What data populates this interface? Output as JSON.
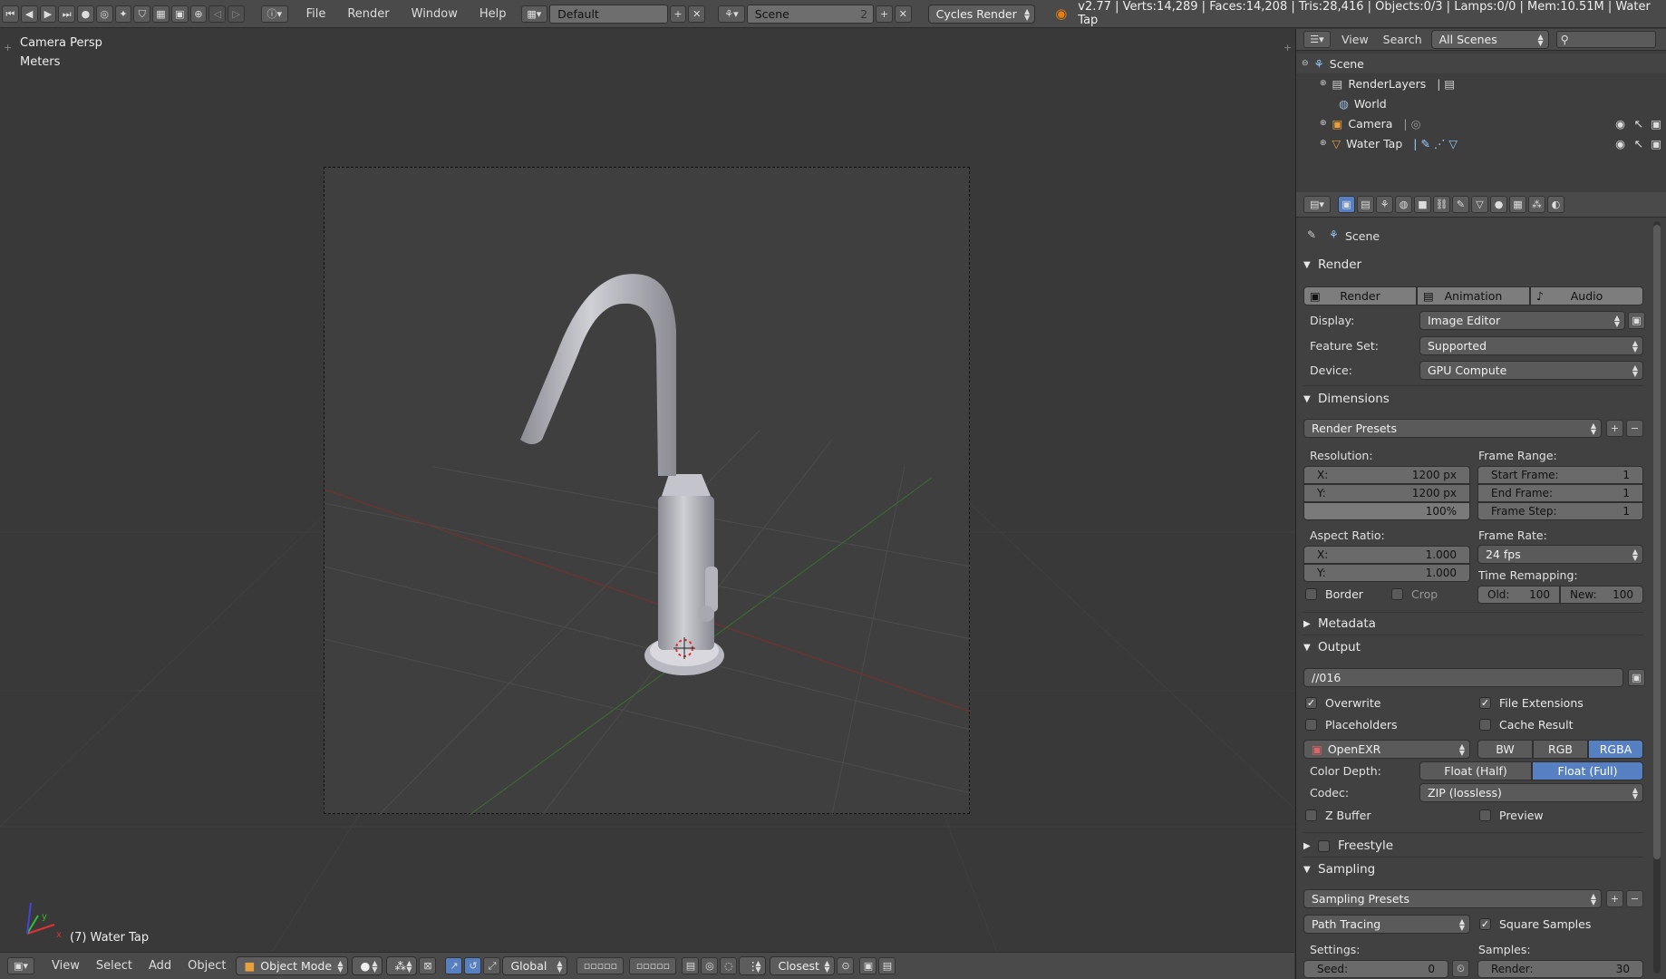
{
  "topbar": {
    "menus": [
      "File",
      "Render",
      "Window",
      "Help"
    ],
    "layout_name": "Default",
    "scene_name": "Scene",
    "scene_users": "2",
    "engine": "Cycles Render",
    "stats": "v2.77 | Verts:14,289 | Faces:14,208 | Tris:28,416 | Objects:0/3 | Lamps:0/0 | Mem:10.51M | Water Tap"
  },
  "viewport": {
    "view_name": "Camera Persp",
    "units": "Meters",
    "object_label": "(7) Water Tap"
  },
  "bottombar": {
    "menus": [
      "View",
      "Select",
      "Add",
      "Object"
    ],
    "mode": "Object Mode",
    "orientation": "Global",
    "snap": "Closest"
  },
  "outliner": {
    "view_label": "View",
    "search_label": "Search",
    "display_mode": "All Scenes",
    "items": [
      {
        "label": "Scene"
      },
      {
        "label": "RenderLayers"
      },
      {
        "label": "World"
      },
      {
        "label": "Camera"
      },
      {
        "label": "Water Tap"
      }
    ]
  },
  "properties": {
    "context": "Scene",
    "render": {
      "title": "Render",
      "buttons": [
        "Render",
        "Animation",
        "Audio"
      ],
      "display_label": "Display:",
      "display_value": "Image Editor",
      "feature_label": "Feature Set:",
      "feature_value": "Supported",
      "device_label": "Device:",
      "device_value": "GPU Compute"
    },
    "dimensions": {
      "title": "Dimensions",
      "presets": "Render Presets",
      "resolution_label": "Resolution:",
      "res_x_label": "X:",
      "res_x": "1200 px",
      "res_y_label": "Y:",
      "res_y": "1200 px",
      "res_pct": "100%",
      "frame_range_label": "Frame Range:",
      "start_label": "Start Frame:",
      "start": "1",
      "end_label": "End Frame:",
      "end": "1",
      "step_label": "Frame Step:",
      "step": "1",
      "aspect_label": "Aspect Ratio:",
      "aspect_x_label": "X:",
      "aspect_x": "1.000",
      "aspect_y_label": "Y:",
      "aspect_y": "1.000",
      "frame_rate_label": "Frame Rate:",
      "frame_rate": "24 fps",
      "border_label": "Border",
      "crop_label": "Crop",
      "remap_label": "Time Remapping:",
      "old_label": "Old:",
      "old": "100",
      "new_label": "New:",
      "new": "100"
    },
    "metadata": {
      "title": "Metadata"
    },
    "output": {
      "title": "Output",
      "path": "//016",
      "overwrite": "Overwrite",
      "file_ext": "File Extensions",
      "placeholders": "Placeholders",
      "cache": "Cache Result",
      "format": "OpenEXR",
      "channels": [
        "BW",
        "RGB",
        "RGBA"
      ],
      "depth_label": "Color Depth:",
      "depths": [
        "Float (Half)",
        "Float (Full)"
      ],
      "codec_label": "Codec:",
      "codec": "ZIP (lossless)",
      "zbuffer": "Z Buffer",
      "preview": "Preview"
    },
    "freestyle": {
      "title": "Freestyle"
    },
    "sampling": {
      "title": "Sampling",
      "presets": "Sampling Presets",
      "integrator": "Path Tracing",
      "square_samples": "Square Samples",
      "settings_label": "Settings:",
      "seed_label": "Seed:",
      "seed": "0",
      "samples_label": "Samples:",
      "render_label": "Render:",
      "render_samples": "30"
    }
  }
}
